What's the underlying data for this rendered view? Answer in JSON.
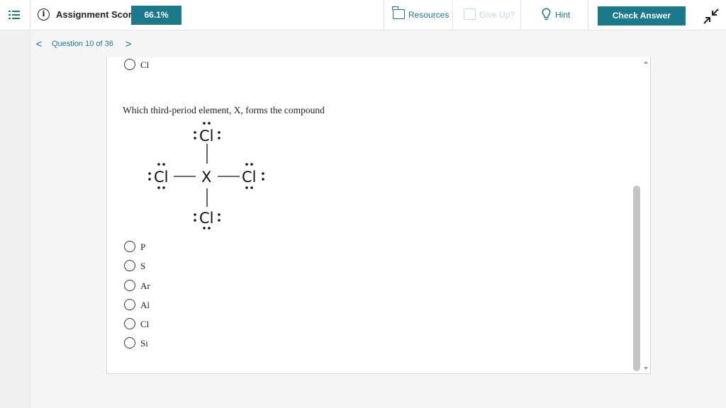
{
  "header": {
    "score_label": "Assignment Score:",
    "score_value": "66.1%",
    "resources_label": "Resources",
    "giveup_label": "Give Up?",
    "hint_label": "Hint",
    "check_label": "Check Answer",
    "icons": [
      "menu-icon",
      "info-icon",
      "folder-icon",
      "give-up-icon",
      "lightbulb-icon",
      "collapse-icon"
    ],
    "accent_color": "#1a7a8c"
  },
  "nav": {
    "prev_symbol": "<",
    "question_label": "Question 10 of 36",
    "next_symbol": ">"
  },
  "previous_question": {
    "last_option": "Cl"
  },
  "question": {
    "text": "Which third-period element, X, forms the compound",
    "structure": {
      "central_atom": "X",
      "top_atom": "Cl",
      "left_atom": "Cl",
      "right_atom": "Cl",
      "bottom_atom": "Cl"
    },
    "options": [
      "P",
      "S",
      "Ar",
      "Al",
      "Cl",
      "Si"
    ]
  }
}
